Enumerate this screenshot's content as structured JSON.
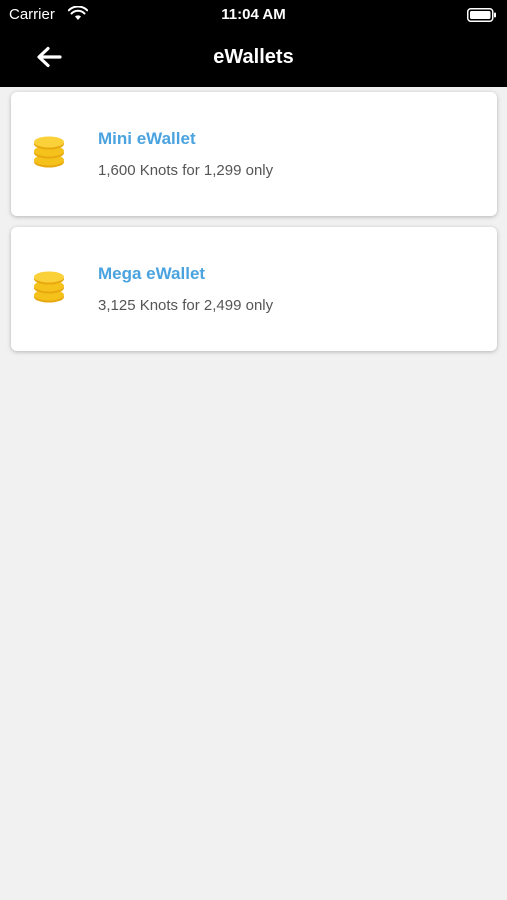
{
  "status_bar": {
    "carrier": "Carrier",
    "time": "11:04 AM"
  },
  "nav": {
    "title": "eWallets",
    "back_icon": "arrow-left-icon"
  },
  "wallets": [
    {
      "icon": "coins-icon",
      "title": "Mini eWallet",
      "subtitle": "1,600 Knots for 1,299 only"
    },
    {
      "icon": "coins-icon",
      "title": "Mega eWallet",
      "subtitle": "3,125 Knots for 2,499 only"
    }
  ],
  "colors": {
    "bar_background": "#000000",
    "page_background": "#f1f1f1",
    "accent": "#4aa3df",
    "coin": "#f5c21b"
  }
}
